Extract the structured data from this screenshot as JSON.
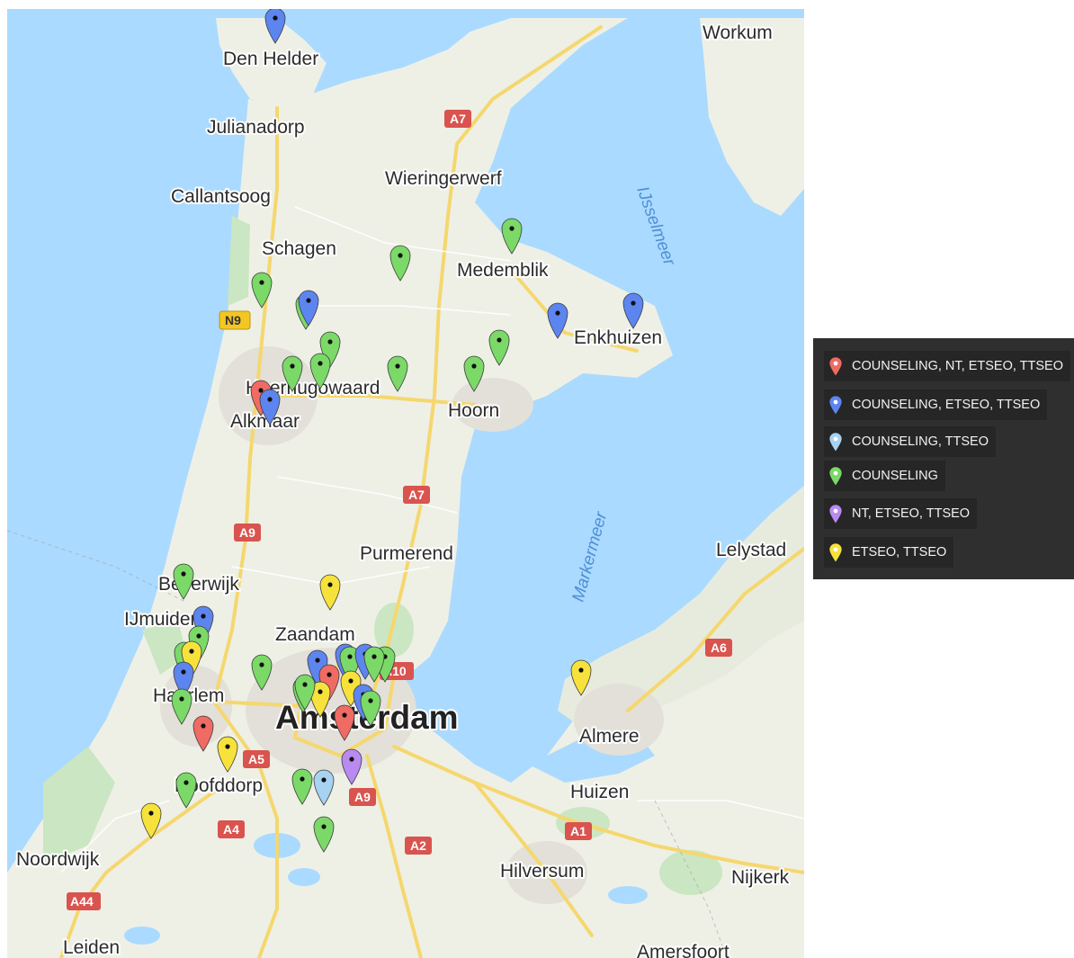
{
  "colors": {
    "water": "#aadaff",
    "land": "#eef0e6",
    "urban": "#e4e2da",
    "park": "#cbe6c2",
    "highway": "#f5d76e",
    "shield_red": "#d9534f",
    "shield_yellow": "#f3c623",
    "pin_red": "#ef6b63",
    "pin_blue": "#5d85f0",
    "pin_lightblue": "#a7d2f2",
    "pin_green": "#7bd968",
    "pin_purple": "#b98af0",
    "pin_yellow": "#f7e23c",
    "legend_bg": "#2f2f2f"
  },
  "map": {
    "places": [
      "Den Helder",
      "Workum",
      "Julianadorp",
      "Wieringerwerf",
      "Callantsoog",
      "Schagen",
      "Medemblik",
      "Enkhuizen",
      "Heerhugowaard",
      "Alkmaar",
      "Hoorn",
      "Purmerend",
      "Lelystad",
      "Beverwijk",
      "IJmuiden",
      "Zaandam",
      "Haarlem",
      "Amsterdam",
      "Almere",
      "Hoofddorp",
      "Huizen",
      "Noordwijk",
      "Hilversum",
      "Nijkerk",
      "Leiden",
      "Amersfoort"
    ],
    "water_labels": [
      "IJsselmeer",
      "Markermeer"
    ],
    "road_shields": [
      "A7",
      "N9",
      "A7",
      "A9",
      "A10",
      "A5",
      "A9",
      "A4",
      "A2",
      "A1",
      "A6",
      "A44"
    ]
  },
  "legend": {
    "items": [
      {
        "label": "COUNSELING, NT, ETSEO, TTSEO",
        "color": "#ef6b63"
      },
      {
        "label": "COUNSELING, ETSEO, TTSEO",
        "color": "#5d85f0"
      },
      {
        "label": "COUNSELING, TTSEO",
        "color": "#a7d2f2"
      },
      {
        "label": "COUNSELING",
        "color": "#7bd968"
      },
      {
        "label": "NT, ETSEO, TTSEO",
        "color": "#b98af0"
      },
      {
        "label": "ETSEO, TTSEO",
        "color": "#f7e23c"
      }
    ]
  },
  "markers": [
    {
      "category": "COUNSELING, ETSEO, TTSEO",
      "color": "#5d85f0"
    },
    {
      "category": "COUNSELING",
      "color": "#7bd968"
    },
    {
      "category": "COUNSELING",
      "color": "#7bd968"
    },
    {
      "category": "COUNSELING",
      "color": "#7bd968"
    },
    {
      "category": "COUNSELING",
      "color": "#7bd968"
    },
    {
      "category": "COUNSELING, ETSEO, TTSEO",
      "color": "#5d85f0"
    },
    {
      "category": "COUNSELING",
      "color": "#7bd968"
    },
    {
      "category": "COUNSELING",
      "color": "#7bd968"
    },
    {
      "category": "COUNSELING",
      "color": "#7bd968"
    },
    {
      "category": "COUNSELING, ETSEO, TTSEO",
      "color": "#5d85f0"
    },
    {
      "category": "COUNSELING, ETSEO, TTSEO",
      "color": "#5d85f0"
    },
    {
      "category": "COUNSELING",
      "color": "#7bd968"
    },
    {
      "category": "COUNSELING",
      "color": "#7bd968"
    },
    {
      "category": "COUNSELING",
      "color": "#7bd968"
    },
    {
      "category": "COUNSELING, NT, ETSEO, TTSEO",
      "color": "#ef6b63"
    },
    {
      "category": "COUNSELING, ETSEO, TTSEO",
      "color": "#5d85f0"
    },
    {
      "category": "COUNSELING",
      "color": "#7bd968"
    },
    {
      "category": "ETSEO, TTSEO",
      "color": "#f7e23c"
    },
    {
      "category": "COUNSELING, ETSEO, TTSEO",
      "color": "#5d85f0"
    },
    {
      "category": "COUNSELING",
      "color": "#7bd968"
    },
    {
      "category": "COUNSELING",
      "color": "#7bd968"
    },
    {
      "category": "ETSEO, TTSEO",
      "color": "#f7e23c"
    },
    {
      "category": "COUNSELING",
      "color": "#7bd968"
    },
    {
      "category": "COUNSELING, ETSEO, TTSEO",
      "color": "#5d85f0"
    },
    {
      "category": "COUNSELING",
      "color": "#7bd968"
    },
    {
      "category": "COUNSELING, NT, ETSEO, TTSEO",
      "color": "#ef6b63"
    },
    {
      "category": "ETSEO, TTSEO",
      "color": "#f7e23c"
    },
    {
      "category": "COUNSELING",
      "color": "#7bd968"
    },
    {
      "category": "COUNSELING, ETSEO, TTSEO",
      "color": "#5d85f0"
    },
    {
      "category": "COUNSELING, ETSEO, TTSEO",
      "color": "#5d85f0"
    },
    {
      "category": "COUNSELING",
      "color": "#7bd968"
    },
    {
      "category": "COUNSELING, NT, ETSEO, TTSEO",
      "color": "#ef6b63"
    },
    {
      "category": "COUNSELING",
      "color": "#7bd968"
    },
    {
      "category": "ETSEO, TTSEO",
      "color": "#f7e23c"
    },
    {
      "category": "COUNSELING",
      "color": "#7bd968"
    },
    {
      "category": "ETSEO, TTSEO",
      "color": "#f7e23c"
    },
    {
      "category": "COUNSELING, ETSEO, TTSEO",
      "color": "#5d85f0"
    },
    {
      "category": "COUNSELING",
      "color": "#7bd968"
    },
    {
      "category": "COUNSELING, ETSEO, TTSEO",
      "color": "#5d85f0"
    },
    {
      "category": "COUNSELING",
      "color": "#7bd968"
    },
    {
      "category": "COUNSELING, NT, ETSEO, TTSEO",
      "color": "#ef6b63"
    },
    {
      "category": "COUNSELING",
      "color": "#7bd968"
    },
    {
      "category": "ETSEO, TTSEO",
      "color": "#f7e23c"
    },
    {
      "category": "NT, ETSEO, TTSEO",
      "color": "#b98af0"
    },
    {
      "category": "COUNSELING",
      "color": "#7bd968"
    },
    {
      "category": "COUNSELING, TTSEO",
      "color": "#a7d2f2"
    },
    {
      "category": "COUNSELING",
      "color": "#7bd968"
    },
    {
      "category": "ETSEO, TTSEO",
      "color": "#f7e23c"
    }
  ]
}
